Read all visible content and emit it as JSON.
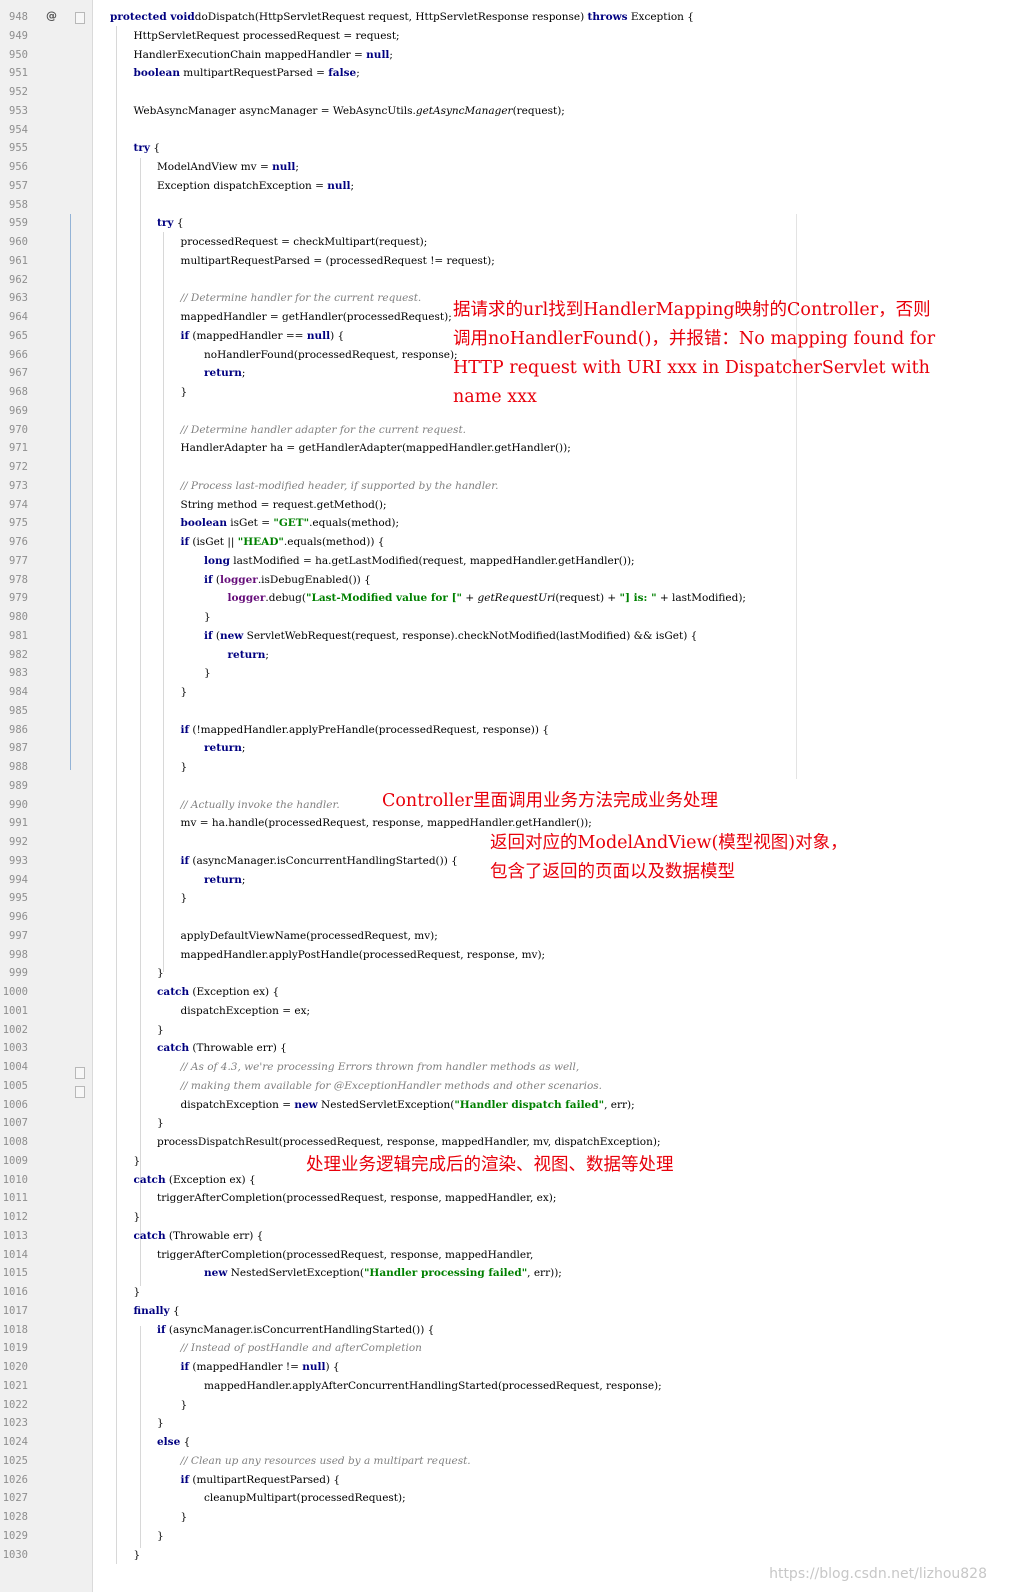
{
  "watermark": "https://blog.csdn.net/lizhou828",
  "annotations": [
    {
      "text": "据请求的url找到HandlerMapping映射的Controller，否则\n调用noHandlerFound()，并报错：No mapping found for\nHTTP request with URI xxx in DispatcherServlet with\nname xxx"
    },
    {
      "text": "Controller里面调用业务方法完成业务处理"
    },
    {
      "text": "返回对应的ModelAndView(模型视图)对象，\n包含了返回的页面以及数据模型"
    },
    {
      "text": "处理业务逻辑完成后的渲染、视图、数据等处理"
    }
  ],
  "lines": [
    {
      "n": "948",
      "i": 0,
      "t": [
        [
          "kw",
          "protected void"
        ],
        [
          "",
          "doDispatch(HttpServletRequest request, HttpServletResponse response) "
        ],
        [
          "kw",
          "throws"
        ],
        [
          "",
          " Exception {"
        ]
      ]
    },
    {
      "n": "949",
      "i": 1,
      "t": [
        [
          "",
          "HttpServletRequest processedRequest = request;"
        ]
      ]
    },
    {
      "n": "950",
      "i": 1,
      "t": [
        [
          "",
          "HandlerExecutionChain mappedHandler = "
        ],
        [
          "kw",
          "null"
        ],
        [
          "",
          ";"
        ]
      ]
    },
    {
      "n": "951",
      "i": 1,
      "t": [
        [
          "kw",
          "boolean"
        ],
        [
          "",
          " multipartRequestParsed = "
        ],
        [
          "kw",
          "false"
        ],
        [
          "",
          ";"
        ]
      ]
    },
    {
      "n": "952",
      "i": 0,
      "t": []
    },
    {
      "n": "953",
      "i": 1,
      "t": [
        [
          "",
          "WebAsyncManager asyncManager = WebAsyncUtils."
        ],
        [
          "it",
          "getAsyncManager"
        ],
        [
          "",
          "(request);"
        ]
      ]
    },
    {
      "n": "954",
      "i": 0,
      "t": []
    },
    {
      "n": "955",
      "i": 1,
      "t": [
        [
          "kw",
          "try"
        ],
        [
          "",
          " {"
        ]
      ]
    },
    {
      "n": "956",
      "i": 2,
      "t": [
        [
          "",
          "ModelAndView mv = "
        ],
        [
          "kw",
          "null"
        ],
        [
          "",
          ";"
        ]
      ]
    },
    {
      "n": "957",
      "i": 2,
      "t": [
        [
          "",
          "Exception dispatchException = "
        ],
        [
          "kw",
          "null"
        ],
        [
          "",
          ";"
        ]
      ]
    },
    {
      "n": "958",
      "i": 0,
      "t": []
    },
    {
      "n": "959",
      "i": 2,
      "t": [
        [
          "kw",
          "try"
        ],
        [
          "",
          " {"
        ]
      ]
    },
    {
      "n": "960",
      "i": 3,
      "t": [
        [
          "",
          "processedRequest = checkMultipart(request);"
        ]
      ]
    },
    {
      "n": "961",
      "i": 3,
      "t": [
        [
          "",
          "multipartRequestParsed = (processedRequest != request);"
        ]
      ]
    },
    {
      "n": "962",
      "i": 0,
      "t": []
    },
    {
      "n": "963",
      "i": 3,
      "t": [
        [
          "cm",
          "// Determine handler for the current request."
        ]
      ]
    },
    {
      "n": "964",
      "i": 3,
      "t": [
        [
          "",
          "mappedHandler = getHandler(processedRequest);"
        ]
      ]
    },
    {
      "n": "965",
      "i": 3,
      "t": [
        [
          "kw",
          "if"
        ],
        [
          "",
          " (mappedHandler == "
        ],
        [
          "kw",
          "null"
        ],
        [
          "",
          ") {"
        ]
      ]
    },
    {
      "n": "966",
      "i": 4,
      "t": [
        [
          "",
          "noHandlerFound(processedRequest, response);"
        ]
      ]
    },
    {
      "n": "967",
      "i": 4,
      "t": [
        [
          "kw",
          "return"
        ],
        [
          "",
          ";"
        ]
      ]
    },
    {
      "n": "968",
      "i": 3,
      "t": [
        [
          "",
          "}"
        ]
      ]
    },
    {
      "n": "969",
      "i": 0,
      "t": []
    },
    {
      "n": "970",
      "i": 3,
      "t": [
        [
          "cm",
          "// Determine handler adapter for the current request."
        ]
      ]
    },
    {
      "n": "971",
      "i": 3,
      "t": [
        [
          "",
          "HandlerAdapter ha = getHandlerAdapter(mappedHandler.getHandler());"
        ]
      ]
    },
    {
      "n": "972",
      "i": 0,
      "t": []
    },
    {
      "n": "973",
      "i": 3,
      "t": [
        [
          "cm",
          "// Process last-modified header, if supported by the handler."
        ]
      ]
    },
    {
      "n": "974",
      "i": 3,
      "t": [
        [
          "",
          "String method = request.getMethod();"
        ]
      ]
    },
    {
      "n": "975",
      "i": 3,
      "t": [
        [
          "kw",
          "boolean"
        ],
        [
          "",
          " isGet = "
        ],
        [
          "str",
          "\"GET\""
        ],
        [
          "",
          ".equals(method);"
        ]
      ]
    },
    {
      "n": "976",
      "i": 3,
      "t": [
        [
          "kw",
          "if"
        ],
        [
          "",
          " (isGet || "
        ],
        [
          "str",
          "\"HEAD\""
        ],
        [
          "",
          ".equals(method)) {"
        ]
      ]
    },
    {
      "n": "977",
      "i": 4,
      "t": [
        [
          "kw",
          "long"
        ],
        [
          "",
          " lastModified = ha.getLastModified(request, mappedHandler.getHandler());"
        ]
      ]
    },
    {
      "n": "978",
      "i": 4,
      "t": [
        [
          "kw",
          "if"
        ],
        [
          "",
          " ("
        ],
        [
          "fld",
          "logger"
        ],
        [
          "",
          ".isDebugEnabled()) {"
        ]
      ]
    },
    {
      "n": "979",
      "i": 5,
      "t": [
        [
          "fld",
          "logger"
        ],
        [
          "",
          ".debug("
        ],
        [
          "str",
          "\"Last-Modified value for [\""
        ],
        [
          "",
          " + "
        ],
        [
          "it",
          "getRequestUri"
        ],
        [
          "",
          "(request) + "
        ],
        [
          "str",
          "\"] is: \""
        ],
        [
          "",
          " + lastModified);"
        ]
      ]
    },
    {
      "n": "980",
      "i": 4,
      "t": [
        [
          "",
          "}"
        ]
      ]
    },
    {
      "n": "981",
      "i": 4,
      "t": [
        [
          "kw",
          "if"
        ],
        [
          "",
          " ("
        ],
        [
          "kw",
          "new"
        ],
        [
          "",
          " ServletWebRequest(request, response).checkNotModified(lastModified) && isGet) {"
        ]
      ]
    },
    {
      "n": "982",
      "i": 5,
      "t": [
        [
          "kw",
          "return"
        ],
        [
          "",
          ";"
        ]
      ]
    },
    {
      "n": "983",
      "i": 4,
      "t": [
        [
          "",
          "}"
        ]
      ]
    },
    {
      "n": "984",
      "i": 3,
      "t": [
        [
          "",
          "}"
        ]
      ]
    },
    {
      "n": "985",
      "i": 0,
      "t": []
    },
    {
      "n": "986",
      "i": 3,
      "t": [
        [
          "kw",
          "if"
        ],
        [
          "",
          " (!mappedHandler.applyPreHandle(processedRequest, response)) {"
        ]
      ]
    },
    {
      "n": "987",
      "i": 4,
      "t": [
        [
          "kw",
          "return"
        ],
        [
          "",
          ";"
        ]
      ]
    },
    {
      "n": "988",
      "i": 3,
      "t": [
        [
          "",
          "}"
        ]
      ]
    },
    {
      "n": "989",
      "i": 0,
      "t": []
    },
    {
      "n": "990",
      "i": 3,
      "t": [
        [
          "cm",
          "// Actually invoke the handler."
        ]
      ]
    },
    {
      "n": "991",
      "i": 3,
      "t": [
        [
          "",
          "mv = ha.handle(processedRequest, response, mappedHandler.getHandler());"
        ]
      ]
    },
    {
      "n": "992",
      "i": 0,
      "t": []
    },
    {
      "n": "993",
      "i": 3,
      "t": [
        [
          "kw",
          "if"
        ],
        [
          "",
          " (asyncManager.isConcurrentHandlingStarted()) {"
        ]
      ]
    },
    {
      "n": "994",
      "i": 4,
      "t": [
        [
          "kw",
          "return"
        ],
        [
          "",
          ";"
        ]
      ]
    },
    {
      "n": "995",
      "i": 3,
      "t": [
        [
          "",
          "}"
        ]
      ]
    },
    {
      "n": "996",
      "i": 0,
      "t": []
    },
    {
      "n": "997",
      "i": 3,
      "t": [
        [
          "",
          "applyDefaultViewName(processedRequest, mv);"
        ]
      ]
    },
    {
      "n": "998",
      "i": 3,
      "t": [
        [
          "",
          "mappedHandler.applyPostHandle(processedRequest, response, mv);"
        ]
      ]
    },
    {
      "n": "999",
      "i": 2,
      "t": [
        [
          "",
          "}"
        ]
      ]
    },
    {
      "n": "1000",
      "i": 2,
      "t": [
        [
          "kw",
          "catch"
        ],
        [
          "",
          " (Exception ex) {"
        ]
      ]
    },
    {
      "n": "1001",
      "i": 3,
      "t": [
        [
          "",
          "dispatchException = ex;"
        ]
      ]
    },
    {
      "n": "1002",
      "i": 2,
      "t": [
        [
          "",
          "}"
        ]
      ]
    },
    {
      "n": "1003",
      "i": 2,
      "t": [
        [
          "kw",
          "catch"
        ],
        [
          "",
          " (Throwable err) {"
        ]
      ]
    },
    {
      "n": "1004",
      "i": 3,
      "t": [
        [
          "cm",
          "// As of 4.3, we're processing Errors thrown from handler methods as well,"
        ]
      ]
    },
    {
      "n": "1005",
      "i": 3,
      "t": [
        [
          "cm",
          "// making them available for @ExceptionHandler methods and other scenarios."
        ]
      ]
    },
    {
      "n": "1006",
      "i": 3,
      "t": [
        [
          "",
          "dispatchException = "
        ],
        [
          "kw",
          "new"
        ],
        [
          "",
          " NestedServletException("
        ],
        [
          "str",
          "\"Handler dispatch failed\""
        ],
        [
          "",
          ", err);"
        ]
      ]
    },
    {
      "n": "1007",
      "i": 2,
      "t": [
        [
          "",
          "}"
        ]
      ]
    },
    {
      "n": "1008",
      "i": 2,
      "t": [
        [
          "",
          "processDispatchResult(processedRequest, response, mappedHandler, mv, dispatchException);"
        ]
      ]
    },
    {
      "n": "1009",
      "i": 1,
      "t": [
        [
          "",
          "}"
        ]
      ]
    },
    {
      "n": "1010",
      "i": 1,
      "t": [
        [
          "kw",
          "catch"
        ],
        [
          "",
          " (Exception ex) {"
        ]
      ]
    },
    {
      "n": "1011",
      "i": 2,
      "t": [
        [
          "",
          "triggerAfterCompletion(processedRequest, response, mappedHandler, ex);"
        ]
      ]
    },
    {
      "n": "1012",
      "i": 1,
      "t": [
        [
          "",
          "}"
        ]
      ]
    },
    {
      "n": "1013",
      "i": 1,
      "t": [
        [
          "kw",
          "catch"
        ],
        [
          "",
          " (Throwable err) {"
        ]
      ]
    },
    {
      "n": "1014",
      "i": 2,
      "t": [
        [
          "",
          "triggerAfterCompletion(processedRequest, response, mappedHandler,"
        ]
      ]
    },
    {
      "n": "1015",
      "i": 4,
      "t": [
        [
          "kw",
          "new"
        ],
        [
          "",
          " NestedServletException("
        ],
        [
          "str",
          "\"Handler processing failed\""
        ],
        [
          "",
          ", err));"
        ]
      ]
    },
    {
      "n": "1016",
      "i": 1,
      "t": [
        [
          "",
          "}"
        ]
      ]
    },
    {
      "n": "1017",
      "i": 1,
      "t": [
        [
          "kw",
          "finally"
        ],
        [
          "",
          " {"
        ]
      ]
    },
    {
      "n": "1018",
      "i": 2,
      "t": [
        [
          "kw",
          "if"
        ],
        [
          "",
          " (asyncManager.isConcurrentHandlingStarted()) {"
        ]
      ]
    },
    {
      "n": "1019",
      "i": 3,
      "t": [
        [
          "cm",
          "// Instead of postHandle and afterCompletion"
        ]
      ]
    },
    {
      "n": "1020",
      "i": 3,
      "t": [
        [
          "kw",
          "if"
        ],
        [
          "",
          " (mappedHandler != "
        ],
        [
          "kw",
          "null"
        ],
        [
          "",
          ") {"
        ]
      ]
    },
    {
      "n": "1021",
      "i": 4,
      "t": [
        [
          "",
          "mappedHandler.applyAfterConcurrentHandlingStarted(processedRequest, response);"
        ]
      ]
    },
    {
      "n": "1022",
      "i": 3,
      "t": [
        [
          "",
          "}"
        ]
      ]
    },
    {
      "n": "1023",
      "i": 2,
      "t": [
        [
          "",
          "}"
        ]
      ]
    },
    {
      "n": "1024",
      "i": 2,
      "t": [
        [
          "kw",
          "else"
        ],
        [
          "",
          " {"
        ]
      ]
    },
    {
      "n": "1025",
      "i": 3,
      "t": [
        [
          "cm",
          "// Clean up any resources used by a multipart request."
        ]
      ]
    },
    {
      "n": "1026",
      "i": 3,
      "t": [
        [
          "kw",
          "if"
        ],
        [
          "",
          " (multipartRequestParsed) {"
        ]
      ]
    },
    {
      "n": "1027",
      "i": 4,
      "t": [
        [
          "",
          "cleanupMultipart(processedRequest);"
        ]
      ]
    },
    {
      "n": "1028",
      "i": 3,
      "t": [
        [
          "",
          "}"
        ]
      ]
    },
    {
      "n": "1029",
      "i": 2,
      "t": [
        [
          "",
          "}"
        ]
      ]
    },
    {
      "n": "1030",
      "i": 1,
      "t": [
        [
          "",
          "}"
        ]
      ]
    }
  ]
}
